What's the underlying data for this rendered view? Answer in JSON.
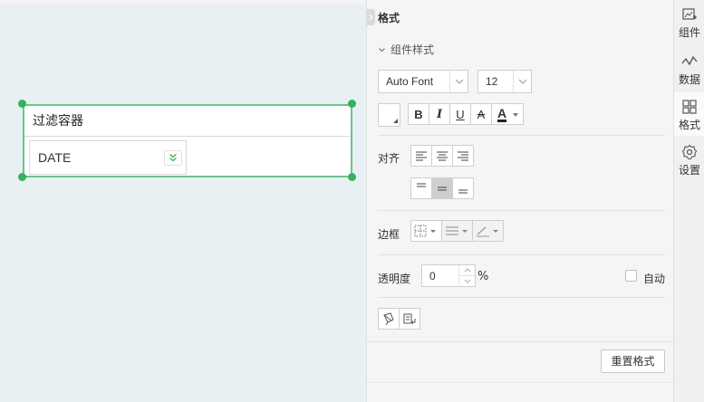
{
  "canvas": {
    "widget": {
      "title": "过滤容器",
      "combo_value": "DATE"
    }
  },
  "panel": {
    "header": "格式",
    "section_title": "组件样式",
    "font_family": "Auto Font",
    "font_size": "12",
    "style_buttons": {
      "bold": "B",
      "italic": "I",
      "underline": "U",
      "strike": "A",
      "color": "A"
    },
    "align_label": "对齐",
    "border_label": "边框",
    "opacity_label": "透明度",
    "opacity_value": "0",
    "opacity_unit": "%",
    "auto_label": "自动",
    "reset_label": "重置格式"
  },
  "rail": {
    "tabs": [
      {
        "label": "组件",
        "icon": "component-add-icon"
      },
      {
        "label": "数据",
        "icon": "data-line-icon"
      },
      {
        "label": "格式",
        "icon": "grid-format-icon"
      },
      {
        "label": "设置",
        "icon": "gear-icon"
      }
    ]
  },
  "colors": {
    "selection": "#35b25e",
    "canvas_bg": "#e9f0f4",
    "panel_bg": "#f5f5f5"
  }
}
